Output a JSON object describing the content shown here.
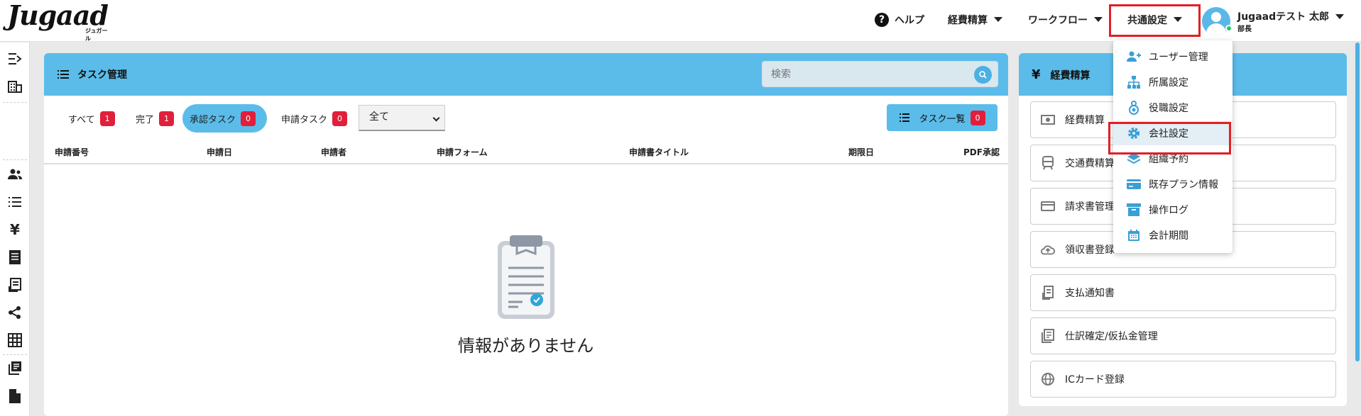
{
  "header": {
    "logo_text": "Jugaad",
    "logo_sub": "ジュガール",
    "nav": {
      "help": "ヘルプ",
      "expense": "経費精算",
      "workflow": "ワークフロー",
      "common_settings": "共通設定"
    },
    "user": {
      "name": "Jugaadテスト 太郎",
      "role": "部長"
    }
  },
  "dropdown": {
    "items": [
      {
        "label": "ユーザー管理",
        "icon": "user-add-icon"
      },
      {
        "label": "所属設定",
        "icon": "org-tree-icon"
      },
      {
        "label": "役職設定",
        "icon": "badge-person-icon"
      },
      {
        "label": "会社設定",
        "icon": "gear-icon"
      },
      {
        "label": "組織予約",
        "icon": "layers-icon"
      },
      {
        "label": "既存プラン情報",
        "icon": "card-icon"
      },
      {
        "label": "操作ログ",
        "icon": "archive-icon"
      },
      {
        "label": "会計期間",
        "icon": "calendar-icon"
      }
    ],
    "highlighted": "会社設定"
  },
  "task_card": {
    "title": "タスク管理",
    "search_placeholder": "検索",
    "tabs": [
      {
        "label": "すべて",
        "count": "1"
      },
      {
        "label": "完了",
        "count": "1"
      },
      {
        "label": "承認タスク",
        "count": "0"
      },
      {
        "label": "申請タスク",
        "count": "0"
      }
    ],
    "active_tab": "承認タスク",
    "filter_value": "全て",
    "tasklist_button": {
      "label": "タスク一覧",
      "count": "0"
    },
    "columns": [
      "申請番号",
      "申請日",
      "申請者",
      "申請フォーム",
      "申請書タイトル",
      "期限日",
      "PDF承認"
    ],
    "empty_message": "情報がありません"
  },
  "expense_card": {
    "title": "経費精算",
    "items": [
      {
        "label": "経費精算",
        "icon": "cash-icon"
      },
      {
        "label": "交通費精算",
        "icon": "train-icon"
      },
      {
        "label": "請求書管理",
        "icon": "credit-card-icon"
      },
      {
        "label": "領収書登録",
        "icon": "cloud-upload-icon"
      },
      {
        "label": "支払通知書",
        "icon": "receipt-icon"
      },
      {
        "label": "仕訳確定/仮払金管理",
        "icon": "ledger-icon"
      },
      {
        "label": "ICカード登録",
        "icon": "globe-icon"
      }
    ]
  },
  "colors": {
    "accent": "#5bbcea",
    "badge": "#e01f3b",
    "highlight_border": "#e01f26"
  }
}
